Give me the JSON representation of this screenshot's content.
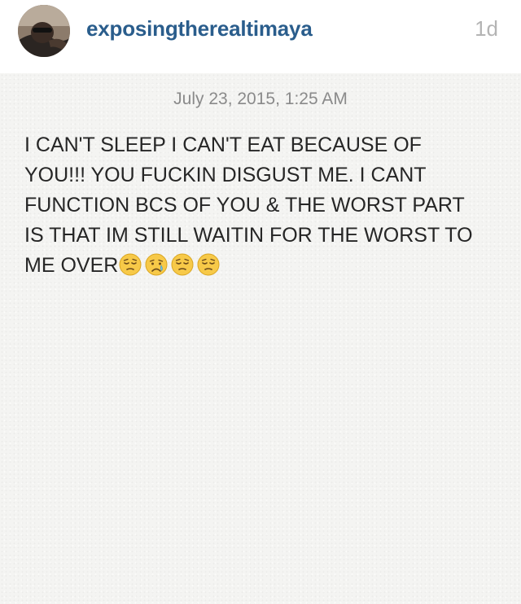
{
  "post": {
    "username": "exposingtherealtimaya",
    "age": "1d"
  },
  "note": {
    "date": "July 23, 2015, 1:25 AM",
    "lines": [
      "I CAN'T SLEEP I CAN'T EAT BECAUSE OF",
      "YOU!!! YOU FUCKIN DISGUST ME. I CANT",
      "FUNCTION BCS OF YOU & THE WORST PART",
      "IS THAT IM STILL WAITIN FOR THE WORST TO",
      "ME OVER"
    ],
    "emojis": [
      "pensive-face-emoji",
      "crying-face-emoji",
      "pensive-face-emoji",
      "pensive-face-emoji"
    ]
  },
  "colors": {
    "username": "#2a5d8c",
    "age": "#b4b4b4",
    "note_background": "#f4f4f2",
    "note_text": "#262626",
    "note_date": "#8a8a8a"
  }
}
